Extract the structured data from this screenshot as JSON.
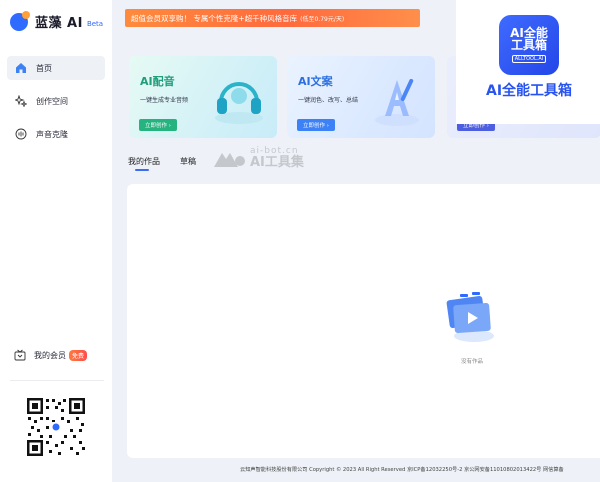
{
  "brand": {
    "name": "蓝藻 AI",
    "beta": "Beta"
  },
  "sidebar": {
    "items": [
      {
        "label": "首页",
        "icon": "home-icon",
        "active": true
      },
      {
        "label": "创作空间",
        "icon": "sparkle-icon",
        "active": false
      },
      {
        "label": "声音克隆",
        "icon": "voice-icon",
        "active": false
      }
    ],
    "member": {
      "label": "我的会员",
      "badge": "免费",
      "icon": "member-icon"
    }
  },
  "promo": {
    "text": "超值会员双享购！ 专属个性克隆+超千种风格音库",
    "price": "(低至0.79元/天)"
  },
  "cards": [
    {
      "title": "AI配音",
      "subtitle": "一键生成专业音频",
      "button": "立即创作 ›"
    },
    {
      "title": "AI文案",
      "subtitle": "一键润色、改写、总结",
      "button": "立即创作 ›"
    },
    {
      "title": "",
      "subtitle": "",
      "button": "立即创作 ›"
    }
  ],
  "tabs": [
    {
      "label": "我的作品",
      "active": true
    },
    {
      "label": "草稿",
      "active": false
    }
  ],
  "watermark": {
    "line1": "ai-bot.cn",
    "line2": "AI工具集"
  },
  "empty": {
    "text": "没有作品"
  },
  "footer": {
    "text": "云知声智能科技股份有限公司 Copyright © 2023 All Right Reserved 京ICP备12032250号-2 京公网安备11010802013422号 网信算备"
  },
  "overlay": {
    "tile_line1": "AI全能",
    "tile_line2": "工具箱",
    "tile_line3": "ALLTOOL.AI",
    "caption": "AI全能工具箱"
  },
  "colors": {
    "accent": "#3c6cf0",
    "promo": "#ff7a3a",
    "green": "#27b37f"
  }
}
